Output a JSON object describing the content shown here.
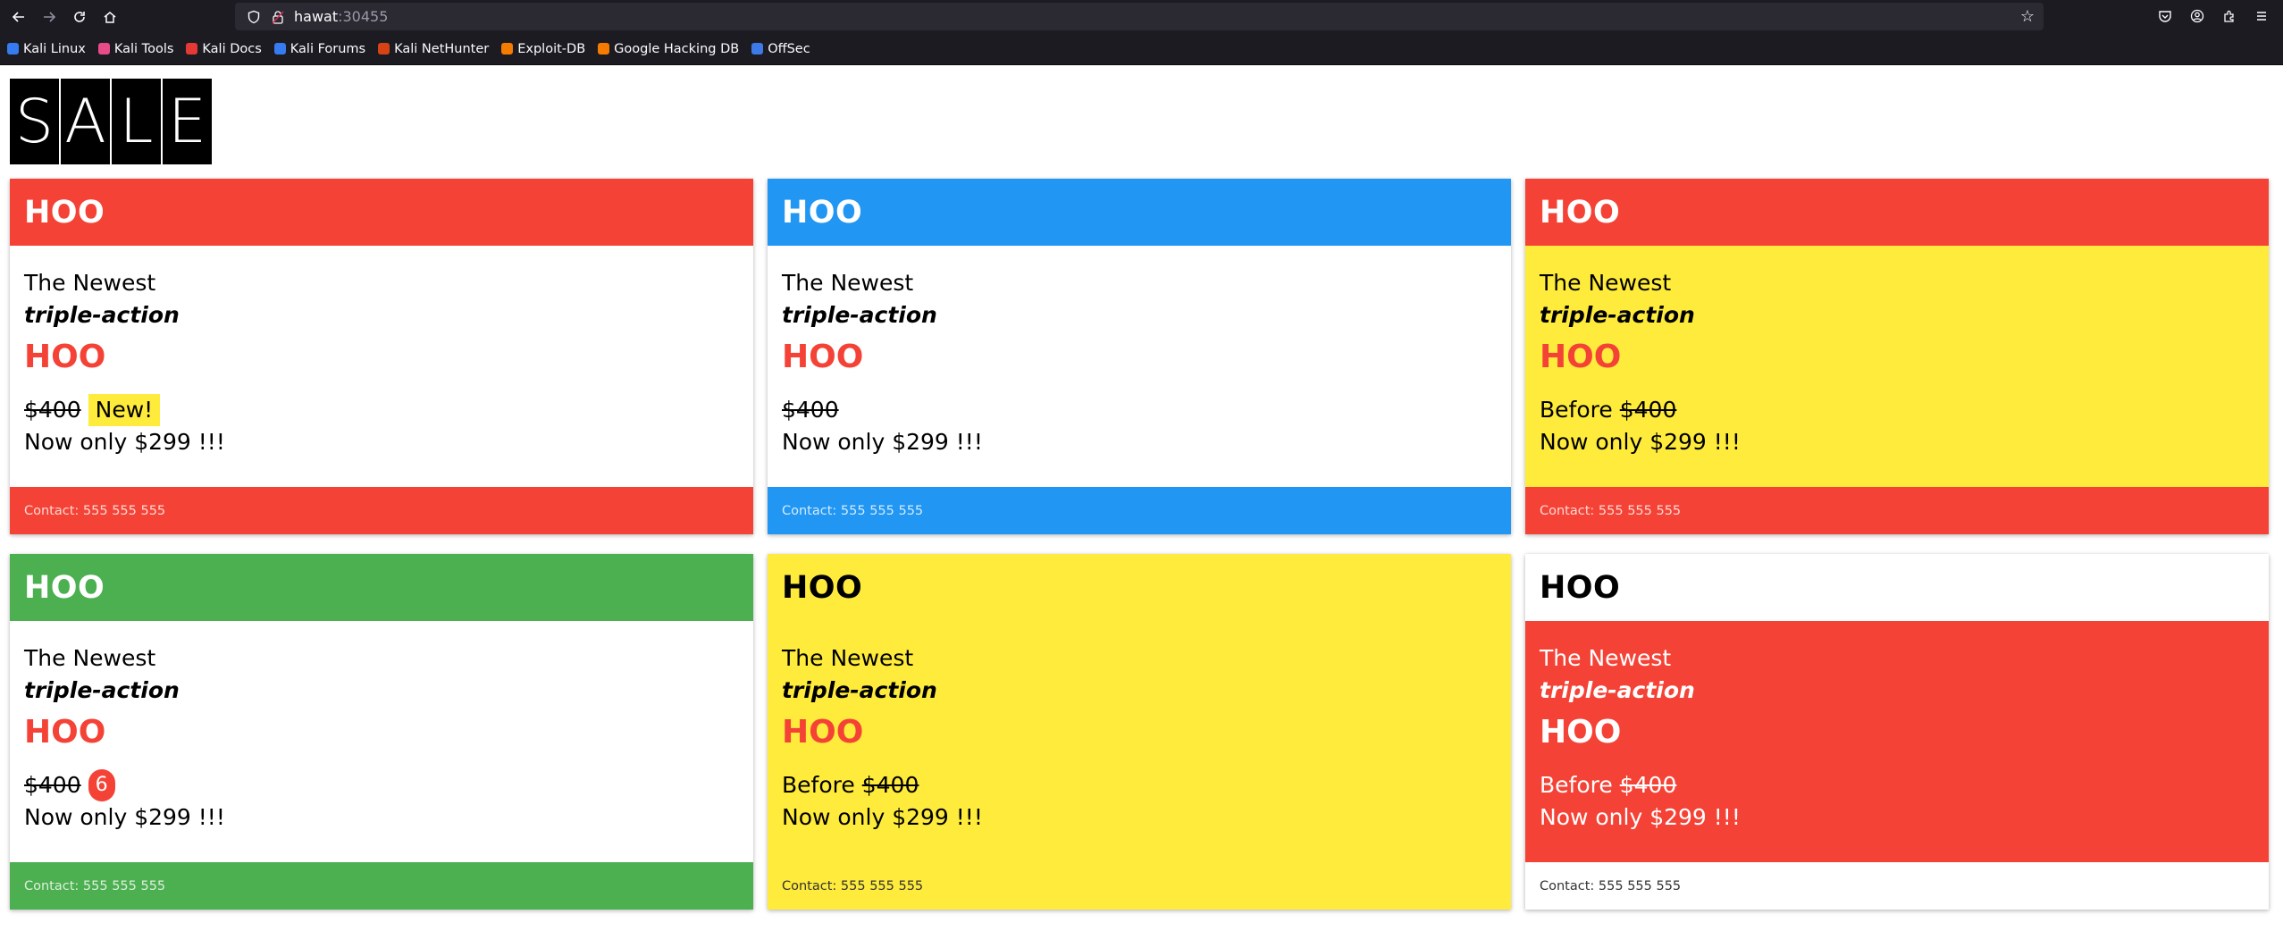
{
  "browser": {
    "url_host": "hawat",
    "url_port": ":30455",
    "bookmarks": [
      {
        "label": "Kali Linux",
        "color": "#367bf0"
      },
      {
        "label": "Kali Tools",
        "color": "#e84b8a"
      },
      {
        "label": "Kali Docs",
        "color": "#e53935"
      },
      {
        "label": "Kali Forums",
        "color": "#367bf0"
      },
      {
        "label": "Kali NetHunter",
        "color": "#d84315"
      },
      {
        "label": "Exploit-DB",
        "color": "#f57c00"
      },
      {
        "label": "Google Hacking DB",
        "color": "#f57c00"
      },
      {
        "label": "OffSec",
        "color": "#3d7ae8"
      }
    ]
  },
  "logo": {
    "letters": [
      "S",
      "A",
      "L",
      "E"
    ]
  },
  "cards": [
    {
      "title": "HOO",
      "line1": "The Newest",
      "line2": "triple-action",
      "product": "HOO",
      "before_label": "",
      "old_price": "$400",
      "tag": "New!",
      "badge": "",
      "now": "Now only $299 !!!",
      "contact": "Contact: 555 555 555",
      "header_color": "#f44336",
      "body_color": "#ffffff",
      "footer_color": "#f44336"
    },
    {
      "title": "HOO",
      "line1": "The Newest",
      "line2": "triple-action",
      "product": "HOO",
      "before_label": "",
      "old_price": "$400",
      "tag": "",
      "badge": "",
      "now": "Now only $299 !!!",
      "contact": "Contact: 555 555 555",
      "header_color": "#2196f3",
      "body_color": "#ffffff",
      "footer_color": "#2196f3"
    },
    {
      "title": "HOO",
      "line1": "The Newest",
      "line2": "triple-action",
      "product": "HOO",
      "before_label": "Before",
      "old_price": "$400",
      "tag": "",
      "badge": "",
      "now": "Now only $299 !!!",
      "contact": "Contact: 555 555 555",
      "header_color": "#f44336",
      "body_color": "#ffeb3b",
      "footer_color": "#f44336"
    },
    {
      "title": "HOO",
      "line1": "The Newest",
      "line2": "triple-action",
      "product": "HOO",
      "before_label": "",
      "old_price": "$400",
      "tag": "",
      "badge": "6",
      "now": "Now only $299 !!!",
      "contact": "Contact: 555 555 555",
      "header_color": "#4caf50",
      "body_color": "#ffffff",
      "footer_color": "#4caf50"
    },
    {
      "title": "HOO",
      "line1": "The Newest",
      "line2": "triple-action",
      "product": "HOO",
      "before_label": "Before",
      "old_price": "$400",
      "tag": "",
      "badge": "",
      "now": "Now only $299 !!!",
      "contact": "Contact: 555 555 555",
      "header_color": "#ffeb3b",
      "body_color": "#ffeb3b",
      "footer_color": "#ffeb3b"
    },
    {
      "title": "HOO",
      "line1": "The Newest",
      "line2": "triple-action",
      "product": "HOO",
      "before_label": "Before",
      "old_price": "$400",
      "tag": "",
      "badge": "",
      "now": "Now only $299 !!!",
      "contact": "Contact: 555 555 555",
      "header_color": "#ffffff",
      "body_color": "#f44336",
      "footer_color": "#ffffff"
    }
  ]
}
